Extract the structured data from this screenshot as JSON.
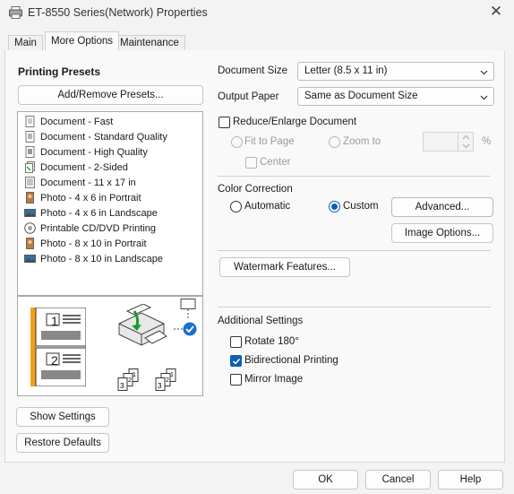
{
  "window": {
    "title": "ET-8550 Series(Network) Properties"
  },
  "tabs": [
    {
      "label": "Main"
    },
    {
      "label": "More Options"
    },
    {
      "label": "Maintenance"
    }
  ],
  "presets": {
    "heading": "Printing Presets",
    "add_remove_label": "Add/Remove Presets...",
    "items": [
      {
        "label": "Document - Fast",
        "icon": "document-fast-icon"
      },
      {
        "label": "Document - Standard Quality",
        "icon": "document-standard-icon"
      },
      {
        "label": "Document - High Quality",
        "icon": "document-high-icon"
      },
      {
        "label": "Document - 2-Sided",
        "icon": "document-2sided-icon"
      },
      {
        "label": "Document - 11 x 17 in",
        "icon": "document-11x17-icon"
      },
      {
        "label": "Photo - 4 x 6 in Portrait",
        "icon": "photo-portrait-icon"
      },
      {
        "label": "Photo - 4 x 6 in Landscape",
        "icon": "photo-landscape-icon"
      },
      {
        "label": "Printable CD/DVD Printing",
        "icon": "cd-dvd-icon"
      },
      {
        "label": "Photo - 8 x 10 in Portrait",
        "icon": "photo-portrait-icon"
      },
      {
        "label": "Photo - 8 x 10 in Landscape",
        "icon": "photo-landscape-icon"
      }
    ],
    "preview_page_numbers": [
      "1",
      "2"
    ]
  },
  "left_buttons": {
    "show_settings": "Show Settings",
    "restore_defaults": "Restore Defaults"
  },
  "document_size": {
    "label": "Document Size",
    "value": "Letter (8.5 x 11 in)"
  },
  "output_paper": {
    "label": "Output Paper",
    "value": "Same as Document Size"
  },
  "reduce_enlarge": {
    "label": "Reduce/Enlarge Document",
    "checked": false,
    "fit_to_page": "Fit to Page",
    "zoom_to": "Zoom to",
    "percent": "%",
    "center": "Center"
  },
  "color_correction": {
    "heading": "Color Correction",
    "automatic": "Automatic",
    "custom": "Custom",
    "selected": "custom",
    "advanced_label": "Advanced...",
    "image_options_label": "Image Options..."
  },
  "watermark": {
    "label": "Watermark Features..."
  },
  "additional_settings": {
    "heading": "Additional Settings",
    "rotate_180": {
      "label": "Rotate 180°",
      "checked": false
    },
    "bidirectional": {
      "label": "Bidirectional Printing",
      "checked": true
    },
    "mirror_image": {
      "label": "Mirror Image",
      "checked": false
    }
  },
  "footer": {
    "ok": "OK",
    "cancel": "Cancel",
    "help": "Help"
  },
  "colors": {
    "accent": "#0a5fb4",
    "preview_bar": "#f0a018"
  }
}
